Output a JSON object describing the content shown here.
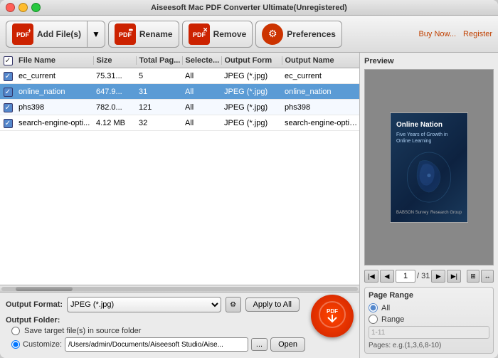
{
  "window": {
    "title": "Aiseesoft Mac PDF Converter Ultimate(Unregistered)"
  },
  "toolbar": {
    "add_files_label": "Add File(s)",
    "rename_label": "Rename",
    "remove_label": "Remove",
    "preferences_label": "Preferences",
    "buy_label": "Buy Now...",
    "register_label": "Register"
  },
  "table": {
    "headers": {
      "filename": "File Name",
      "size": "Size",
      "total_pages": "Total Pag...",
      "selected": "Selecte...",
      "output_format": "Output Form",
      "output_name": "Output Name"
    },
    "rows": [
      {
        "checked": true,
        "name": "ec_current",
        "size": "75.31...",
        "pages": "5",
        "selected": "All",
        "format": "JPEG (*.jpg)",
        "output": "ec_current",
        "selected_row": false
      },
      {
        "checked": true,
        "name": "online_nation",
        "size": "647.9...",
        "pages": "31",
        "selected": "All",
        "format": "JPEG (*.jpg)",
        "output": "online_nation",
        "selected_row": true
      },
      {
        "checked": true,
        "name": "phs398",
        "size": "782.0...",
        "pages": "121",
        "selected": "All",
        "format": "JPEG (*.jpg)",
        "output": "phs398",
        "selected_row": false
      },
      {
        "checked": true,
        "name": "search-engine-opti...",
        "size": "4.12 MB",
        "pages": "32",
        "selected": "All",
        "format": "JPEG (*.jpg)",
        "output": "search-engine-optimizati...",
        "selected_row": false
      }
    ]
  },
  "bottom": {
    "format_label": "Output Format:",
    "format_value": "JPEG (*.jpg)",
    "apply_all_label": "Apply to All",
    "output_folder_label": "Output Folder:",
    "save_source_label": "Save target file(s) in source folder",
    "customize_label": "Customize:",
    "customize_path": "/Users/admin/Documents/Aiseesoft Studio/Aise...",
    "open_label": "Open"
  },
  "preview": {
    "label": "Preview",
    "book_title": "Online Nation",
    "book_subtitle": "Five Years of Growth in Online Learning",
    "current_page": "1",
    "total_pages": "/ 31"
  },
  "page_range": {
    "title": "Page Range",
    "option_all": "All",
    "option_range": "Range",
    "range_value": "1-11",
    "pages_note": "Pages: e.g.(1,3,6,8-10)"
  }
}
